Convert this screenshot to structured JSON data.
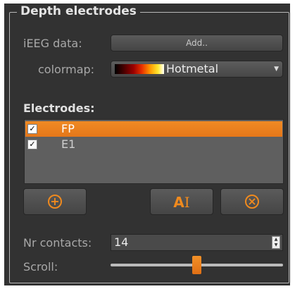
{
  "group": {
    "title": "Depth electrodes"
  },
  "ieeg": {
    "label": "iEEG data:",
    "button_label": "Add.."
  },
  "colormap": {
    "label": "colormap:",
    "selected": "Hotmetal",
    "swatch_icon": "hotmetal-gradient-swatch"
  },
  "electrodes": {
    "title": "Electrodes:",
    "items": [
      {
        "label": "FP",
        "checked": true,
        "selected": true
      },
      {
        "label": "E1",
        "checked": true,
        "selected": false
      }
    ]
  },
  "toolbar": {
    "add_icon": "plus-circle-icon",
    "rename_icon": "font-cursor-icon",
    "rename_text": "A",
    "remove_icon": "x-circle-icon"
  },
  "contacts": {
    "label": "Nr contacts:",
    "value": "14"
  },
  "scroll": {
    "label": "Scroll:",
    "position": 0.5
  },
  "colors": {
    "background": "#323232",
    "accent": "#f08a1e",
    "selection": "#ef8a24"
  }
}
